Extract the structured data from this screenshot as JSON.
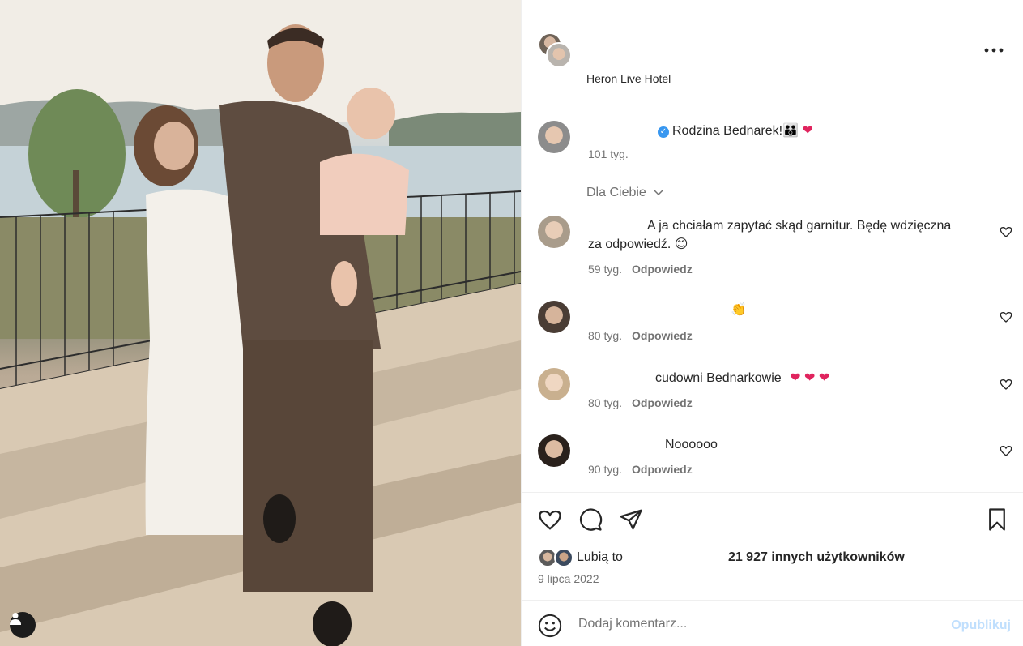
{
  "post": {
    "location": "Heron Live Hotel",
    "more_icon": "more-horizontal-icon"
  },
  "caption": {
    "text": "Rodzina Bednarek!",
    "emoji": "👪 ❤",
    "time": "101 tyg.",
    "verified_icon": "verified-badge-icon"
  },
  "filter": {
    "label": "Dla Ciebie"
  },
  "comments": [
    {
      "text": "A ja chciałam zapytać skąd garnitur. Będę wdzięczna",
      "text_line2": "za odpowiedź. 😊",
      "time": "59 tyg.",
      "reply": "Odpowiedz"
    },
    {
      "text": "👏",
      "time": "80 tyg.",
      "reply": "Odpowiedz"
    },
    {
      "text": "cudowni Bednarkowie",
      "emoji": "❤ ❤ ❤",
      "time": "80 tyg.",
      "reply": "Odpowiedz"
    },
    {
      "text": "Noooooo",
      "time": "90 tyg.",
      "reply": "Odpowiedz"
    }
  ],
  "likes": {
    "label": "Lubią to",
    "others": "21 927 innych użytkowników"
  },
  "date": "9 lipca 2022",
  "composer": {
    "placeholder": "Dodaj komentarz...",
    "publish": "Opublikuj"
  },
  "colors": {
    "text": "#262626",
    "secondary": "#737373",
    "divider": "#efefef",
    "verified": "#3897f0",
    "publish_disabled": "#c0dffd",
    "heart": "#e0245e"
  }
}
